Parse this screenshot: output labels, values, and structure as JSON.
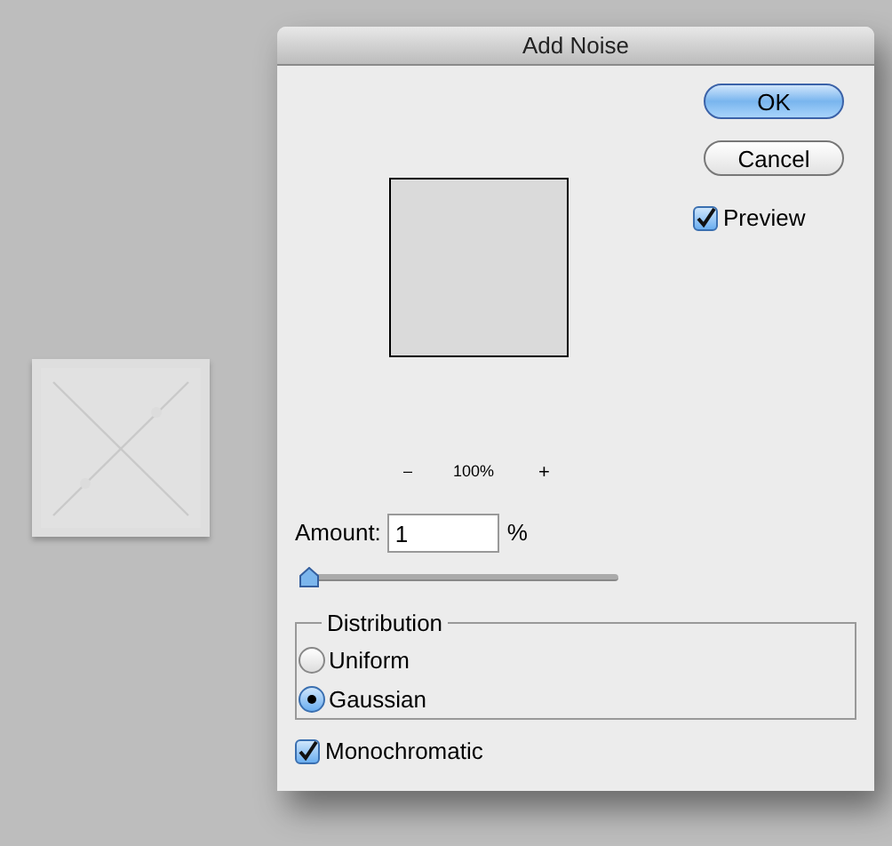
{
  "window": {
    "title": "Add Noise"
  },
  "buttons": [
    {
      "label": "OK",
      "kind": "default"
    },
    {
      "label": "Cancel",
      "kind": "normal"
    }
  ],
  "preview_checkbox": {
    "label": "Preview",
    "checked": true
  },
  "zoom": {
    "zoom_out": "–",
    "value": "100%",
    "zoom_in": "+"
  },
  "amount": {
    "label": "Amount:",
    "value": "1",
    "unit": "%",
    "level": 0
  },
  "distribution": {
    "title": "Distribution",
    "options": [
      {
        "label": "Uniform",
        "selected": false
      },
      {
        "label": "Gaussian",
        "selected": true
      }
    ]
  },
  "monochromatic": {
    "label": "Monochromatic",
    "checked": true
  }
}
